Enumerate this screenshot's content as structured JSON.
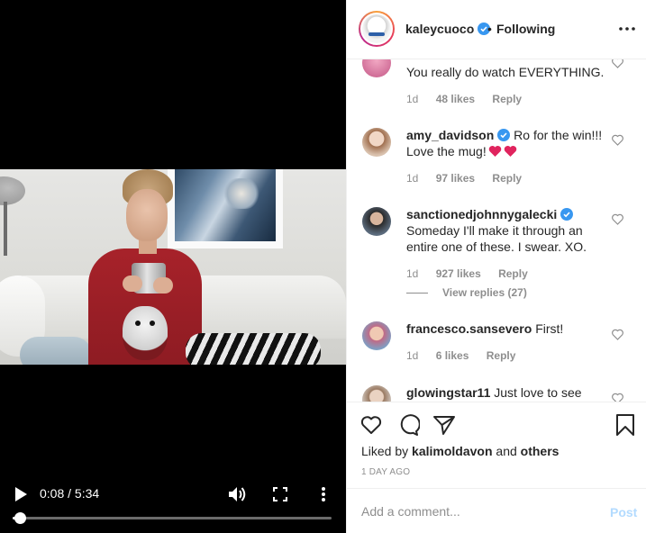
{
  "video": {
    "time_display": "0:08 / 5:34",
    "progress": 0.024,
    "controls": [
      "play-icon",
      "volume-icon",
      "fullscreen-icon",
      "more-vertical-icon"
    ]
  },
  "header": {
    "username": "kaleycuoco",
    "dot": "•",
    "follow_status": "Following"
  },
  "comments": [
    {
      "user": "",
      "text": "You really do watch EVERYTHING.",
      "age": "1d",
      "likes": "48 likes",
      "reply": "Reply"
    },
    {
      "user": "amy_davidson",
      "text": "Ro for the win!!! Love the mug!",
      "age": "1d",
      "likes": "97 likes",
      "reply": "Reply"
    },
    {
      "user": "sanctionedjohnnygalecki",
      "text": "Someday I'll make it through an entire one of these. I swear. XO.",
      "age": "1d",
      "likes": "927 likes",
      "reply": "Reply",
      "view_replies": "View replies (27)"
    },
    {
      "user": "francesco.sansevero",
      "text": "First!",
      "age": "1d",
      "likes": "6 likes",
      "reply": "Reply"
    },
    {
      "user": "glowingstar11",
      "text": "Just love to see"
    }
  ],
  "actions": {
    "liked_by_prefix": "Liked by",
    "liked_by_user": "kalimoldavon",
    "liked_by_and": "and",
    "liked_by_others": "others",
    "timestamp": "1 DAY AGO"
  },
  "add_comment": {
    "placeholder": "Add a comment...",
    "post_label": "Post"
  },
  "colors": {
    "verified": "#3897f0",
    "heart_emoji": "#e0245e",
    "post_disabled": "#b3dbff",
    "meta_gray": "#8e8e8e"
  }
}
